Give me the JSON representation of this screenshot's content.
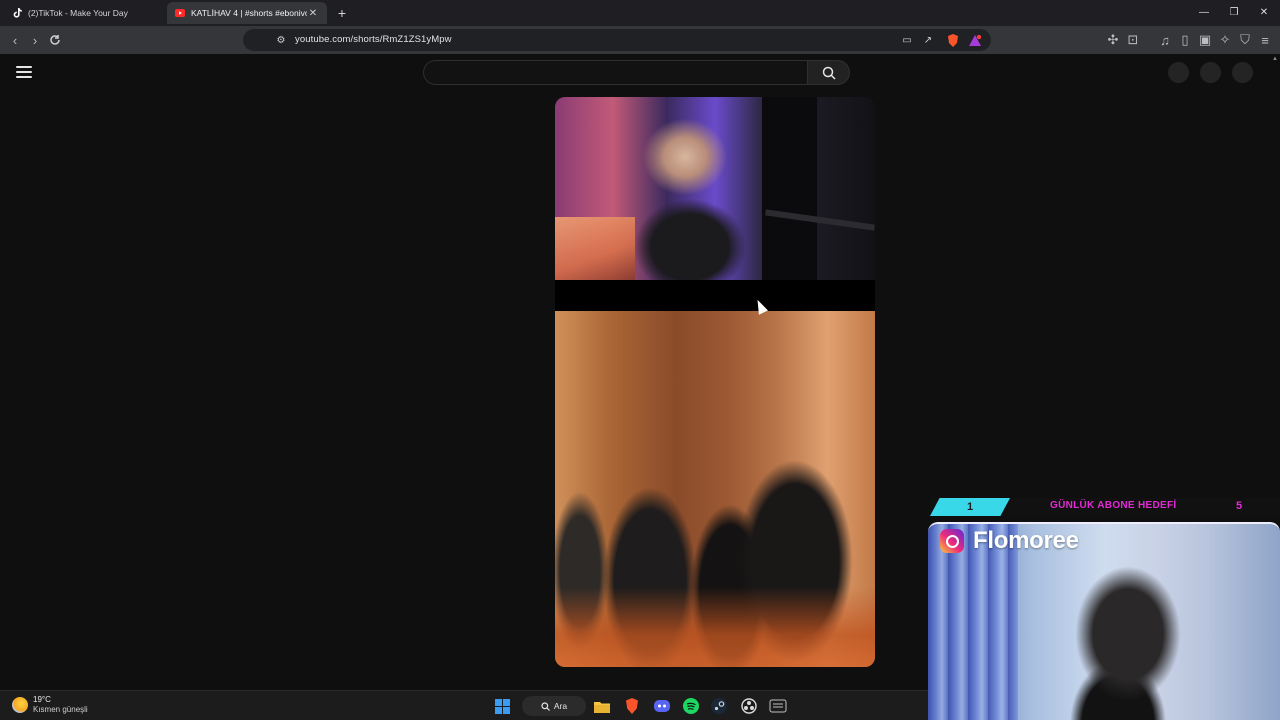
{
  "tabs": [
    {
      "title": "(2)TikTok - Make Your Day",
      "icon": "tiktok-icon",
      "active": false
    },
    {
      "title": "KATLİHAV 4 | #shorts #ebonivon",
      "icon": "youtube-icon",
      "active": true
    }
  ],
  "address_bar": {
    "url": "youtube.com/shorts/RmZ1ZS1yMpw"
  },
  "youtube": {
    "search_placeholder": ""
  },
  "overlay": {
    "goal_left": "1",
    "goal_label": "GÜNLÜK ABONE HEDEFİ",
    "goal_right": "5",
    "instagram_handle": "Flomoree"
  },
  "taskbar": {
    "weather_temp": "19°C",
    "weather_desc": "Kısmen güneşli",
    "search_label": "Ara"
  },
  "colors": {
    "accent_cyan": "#39d8e8",
    "accent_magenta": "#e22bd6",
    "page_bg": "#0f0f0f"
  }
}
